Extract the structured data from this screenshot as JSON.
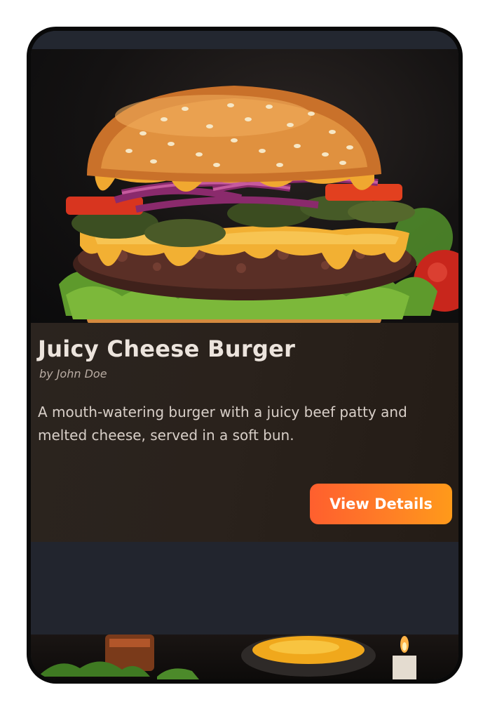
{
  "recipe_card": {
    "title": "Juicy Cheese Burger",
    "author": "by John Doe",
    "description": "A mouth-watering burger with a juicy beef patty and melted cheese, served in a soft bun.",
    "button_label": "View Details",
    "image_subject": "cheeseburger-photo"
  },
  "next_card": {
    "image_subject": "food-spread-photo"
  },
  "colors": {
    "accent_start": "#ff5f2e",
    "accent_end": "#ff9a1a",
    "title_text": "#ece4dd",
    "screen_background": "#22252e"
  }
}
